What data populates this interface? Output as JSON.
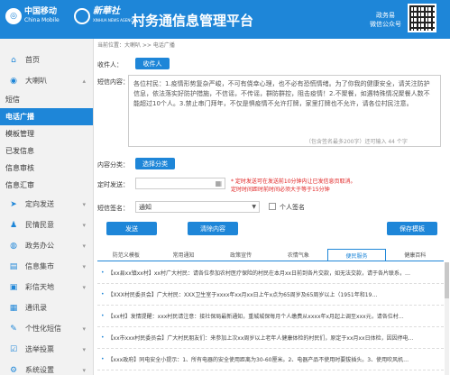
{
  "header": {
    "cm_name": "中国移动",
    "cm_en": "China Mobile",
    "xh_name": "新華社",
    "xh_en": "XINHUA NEWS AGENCY",
    "title": "村务通信息管理平台",
    "wechat_line1": "政务易",
    "wechat_line2": "微信公众号"
  },
  "sidebar": {
    "items": [
      {
        "icon": "home-icon",
        "glyph": "⌂",
        "label": "首页"
      },
      {
        "icon": "speaker-icon",
        "glyph": "◉",
        "label": "大喇叭",
        "arrow": "▴"
      },
      {
        "icon": "send-icon",
        "glyph": "➤",
        "label": "定向发送",
        "arrow": "▾"
      },
      {
        "icon": "people-icon",
        "glyph": "♟",
        "label": "民情民意",
        "arrow": "▾"
      },
      {
        "icon": "globe-icon",
        "glyph": "◍",
        "label": "政务办公",
        "arrow": "▾"
      },
      {
        "icon": "chart-icon",
        "glyph": "▤",
        "label": "信息集市",
        "arrow": "▾"
      },
      {
        "icon": "tv-icon",
        "glyph": "▣",
        "label": "彩信天地",
        "arrow": "▾"
      },
      {
        "icon": "contacts-icon",
        "glyph": "▦",
        "label": "通讯录"
      },
      {
        "icon": "pencil-icon",
        "glyph": "✎",
        "label": "个性化短信",
        "arrow": "▾"
      },
      {
        "icon": "vote-icon",
        "glyph": "☑",
        "label": "选举投票",
        "arrow": "▾"
      },
      {
        "icon": "settings-icon",
        "glyph": "⚙",
        "label": "系统设置",
        "arrow": "▾"
      }
    ],
    "sub_items": [
      "短信",
      "电话广播",
      "模板管理",
      "已发信息",
      "信息审核",
      "信息汇审"
    ]
  },
  "breadcrumb": "当前位置：大喇叭 >> 电话广播",
  "form": {
    "recipient_label": "收件人：",
    "recipient_button": "收件人",
    "content_label": "短信内容：",
    "content_text": "各位村民：1.疫情形势复杂严峻，不可有侥幸心理，也不必有恐慌情绪。为了你我的健康安全，请关注防护信息，依法落实好防护措施，不信谣，不传谣，群防群控，阻击疫情！2.不聚餐，如遇特殊情况聚餐人数不能超过10个人。3.禁止串门拜年，不仅是惧疫情不允许打牌，家里打牌也不允许，请各位村民注意。",
    "count_text": "（包含签名最多200字）还可输入 44 个字",
    "category_label": "内容分类：",
    "category_button": "选择分类",
    "schedule_label": "定时发送：",
    "schedule_value": "",
    "note_line1": "* 定时发送可在发送前10分钟内让已发信息页取消。",
    "note_line2": "定时时间距时前时间必须大于等于15分钟",
    "signature_label": "短信签名：",
    "signature_value": "通知",
    "personal_sign_label": "个人签名",
    "send_button": "发送",
    "clear_button": "清除内容",
    "save_template_button": "保存模板"
  },
  "tabs": [
    "防范义模板",
    "常用通知",
    "政策宣传",
    "农情气象",
    "便民服务",
    "健康百科"
  ],
  "active_tab": 4,
  "list": [
    "【xx县xx镇xx村】xx村广大村民：请各位参加农村医疗保险的村民在本月xx日前到各片交款，如无法交款，请于各片联系，…",
    "【XXX村民委员会】广大村民：XXX卫生室于xxxx年xx月xx日上午x点为65周岁及65周岁以上（1951年和19…",
    "【xx村】发情提醒：xxx村民请注意：接社保局最新通知，重城城保每月个人缴费从xxxx年x月起上调至xxx元，请各位村…",
    "【xx市xxx村民委员会】广大村民朋友们：来参加上次xx周岁以上老年人健康体检的村民们，原定于xx月xx日体检，因因停电…",
    "【xxx政府】同电安全小提示：1、所有电器的安全使用距离为30-60厘米。2、电器产品不使用时要拔插头。3、使用吹风机…"
  ],
  "colors": {
    "accent": "#1e86d8",
    "warning": "#e02020"
  }
}
